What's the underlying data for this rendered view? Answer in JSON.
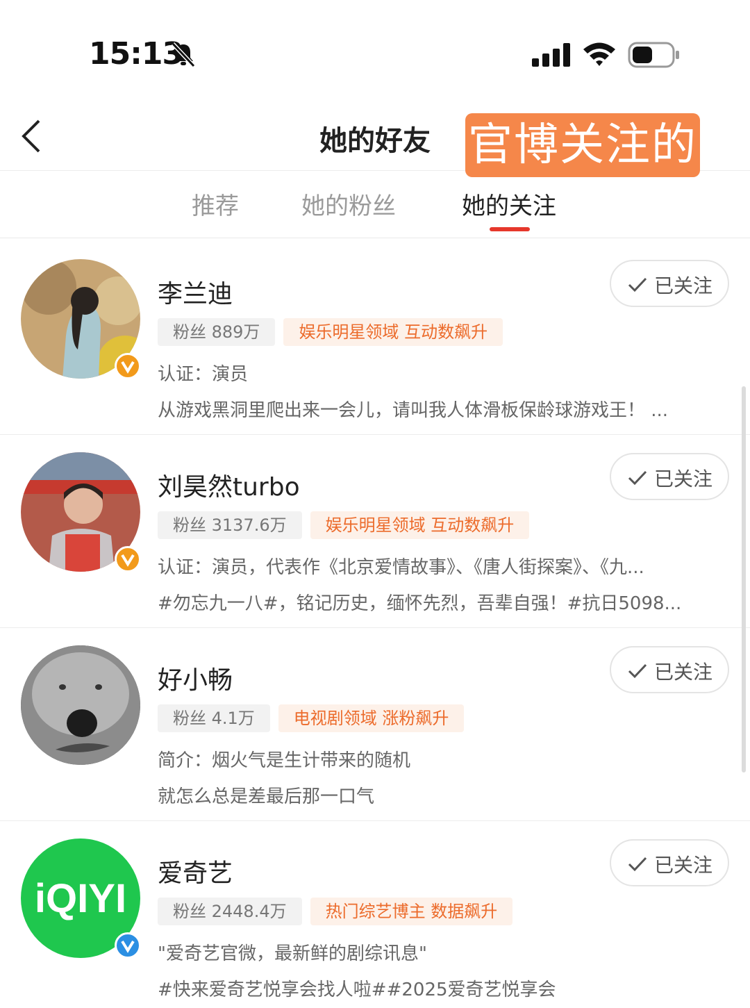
{
  "status_bar": {
    "time": "15:13"
  },
  "nav": {
    "title": "她的好友",
    "annotation": "官博关注的"
  },
  "tabs": [
    {
      "label": "推荐"
    },
    {
      "label": "她的粉丝"
    },
    {
      "label": "她的关注",
      "active": true
    }
  ],
  "users": [
    {
      "name": "李兰迪",
      "fans": "粉丝 889万",
      "tag": "娱乐明星领域 互动数飙升",
      "line1": "认证：演员",
      "line2": "从游戏黑洞里爬出来一会儿，请叫我人体滑板保龄球游戏王！ ...",
      "badge": "orange",
      "follow_label": "已关注"
    },
    {
      "name": "刘昊然turbo",
      "fans": "粉丝 3137.6万",
      "tag": "娱乐明星领域 互动数飙升",
      "line1": "认证：演员，代表作《北京爱情故事》、《唐人街探案》、《九...",
      "line2": "#勿忘九一八#，铭记历史，缅怀先烈，吾辈自强！#抗日5098...",
      "badge": "orange",
      "follow_label": "已关注"
    },
    {
      "name": "好小畅",
      "fans": "粉丝 4.1万",
      "tag": "电视剧领域 涨粉飙升",
      "line1": "简介：烟火气是生计带来的随机",
      "line2": "就怎么总是差最后那一口气",
      "badge": "none",
      "follow_label": "已关注"
    },
    {
      "name": "爱奇艺",
      "fans": "粉丝 2448.4万",
      "tag": "热门综艺博主 数据飙升",
      "line1": "\"爱奇艺官微，最新鲜的剧综讯息\"",
      "line2": "#快来爱奇艺悦享会找人啦##2025爱奇艺悦享会",
      "badge": "blue",
      "avatar_text": "iQIYI",
      "follow_label": "已关注"
    }
  ],
  "colors": {
    "accent": "#e6372b",
    "tag_text": "#ec6b2b",
    "annotation_bg": "#f5874a",
    "iqiyi_green": "#1fc74e"
  }
}
